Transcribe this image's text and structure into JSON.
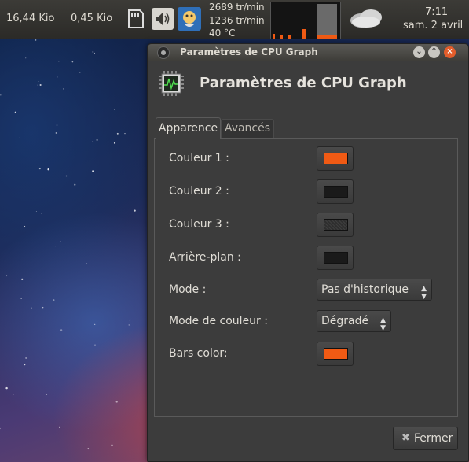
{
  "panel": {
    "net_down": "16,44 Kio",
    "net_up": "0,45 Kio",
    "sensors": [
      "2689 tr/min",
      "1236 tr/min",
      "40 °C"
    ],
    "time": "7:11",
    "date": "sam.  2 avril",
    "icons": [
      "memory-card-icon",
      "volume-icon",
      "messaging-icon",
      "cpu-graph-applet",
      "weather-icon"
    ]
  },
  "dialog": {
    "window_title": "Paramètres de CPU Graph",
    "header_title": "Paramètres de CPU Graph",
    "tabs": [
      "Apparence",
      "Avancés"
    ],
    "active_tab": "Apparence",
    "rows": {
      "color1": {
        "label": "Couleur 1 :",
        "color": "#f05a14"
      },
      "color2": {
        "label": "Couleur 2 :",
        "color": "#1a1a1a"
      },
      "color3": {
        "label": "Couleur 3 :",
        "color": "#2e2e2e"
      },
      "background": {
        "label": "Arrière-plan :",
        "color": "#1a1a1a"
      },
      "mode": {
        "label": "Mode :",
        "value": "Pas d'historique"
      },
      "color_mode": {
        "label": "Mode de couleur :",
        "value": "Dégradé"
      },
      "bars_color": {
        "label": "Bars color:",
        "color": "#f05a14"
      }
    },
    "close_label": "Fermer"
  },
  "colors": {
    "accent_orange": "#f05a14",
    "panel_bg": "#3c3b37",
    "dialog_bg": "#3c3c3c"
  }
}
